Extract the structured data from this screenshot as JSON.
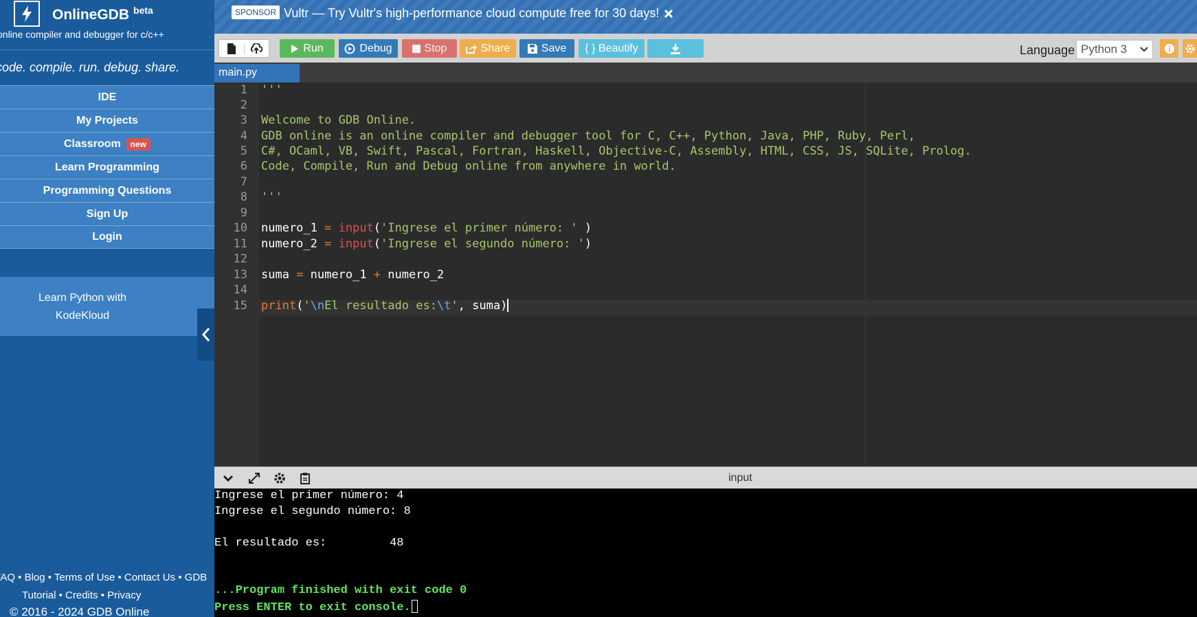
{
  "brand": {
    "name": "OnlineGDB",
    "sup": "beta",
    "tagline": "online compiler and debugger for c/c++",
    "slogan": "code. compile. run. debug. share."
  },
  "nav": {
    "ide": "IDE",
    "projects": "My Projects",
    "classroom": "Classroom",
    "classroom_badge": "new",
    "learn": "Learn Programming",
    "questions": "Programming Questions",
    "signup": "Sign Up",
    "login": "Login"
  },
  "promo": {
    "line1": "Learn Python with",
    "line2": "KodeKloud"
  },
  "footer": {
    "line1": "FAQ • Blog • Terms of Use • Contact Us • GDB",
    "line2": "Tutorial • Credits • Privacy",
    "line3": "© 2016 - 2024 GDB Online"
  },
  "sponsor": {
    "badge": "SPONSOR",
    "text": "Vultr — Try Vultr's high-performance cloud compute free for 30 days!"
  },
  "toolbar": {
    "run": "Run",
    "debug": "Debug",
    "stop": "Stop",
    "share": "Share",
    "save": "Save",
    "beautify": "{ } Beautify",
    "language_label": "Language",
    "language_value": "Python 3",
    "colors": {
      "run": "#5cb85c",
      "debug": "#337ab7",
      "stop": "#d9534f",
      "share": "#f0ad4e",
      "save": "#337ab7",
      "beautify": "#5bc0de",
      "info": "#f0ad4e"
    }
  },
  "tab": {
    "filename": "main.py"
  },
  "editor": {
    "line_numbers": [
      "1",
      "2",
      "3",
      "4",
      "5",
      "6",
      "7",
      "8",
      "9",
      "10",
      "11",
      "12",
      "13",
      "14",
      "15"
    ],
    "l1": "'''",
    "l3": "Welcome to GDB Online.",
    "l4": "GDB online is an online compiler and debugger tool for C, C++, Python, Java, PHP, Ruby, Perl,",
    "l5": "C#, OCaml, VB, Swift, Pascal, Fortran, Haskell, Objective-C, Assembly, HTML, CSS, JS, SQLite, Prolog.",
    "l6": "Code, Compile, Run and Debug online from anywhere in world.",
    "l8": "'''",
    "l10": {
      "var": "numero_1",
      "eq": " = ",
      "fn": "input",
      "open": "(",
      "str": "'Ingrese el primer número: '",
      "close": " )"
    },
    "l11": {
      "var": "numero_2",
      "eq": " = ",
      "fn": "input",
      "open": "(",
      "str": "'Ingrese el segundo número: '",
      "close": ")"
    },
    "l13": {
      "var": "suma",
      "eq": " = ",
      "a": "numero_1",
      "plus": " + ",
      "b": "numero_2"
    },
    "l15": {
      "fn": "print",
      "open": "(",
      "q1": "'",
      "esc1": "\\n",
      "mid": "El resultado es:",
      "esc2": "\\t",
      "q2": "'",
      "comma": ", ",
      "arg": "suma",
      "close": ")"
    }
  },
  "console": {
    "title": "input",
    "lines": [
      "Ingrese el primer número: 4",
      "Ingrese el segundo número: 8",
      "",
      "El resultado es:         48",
      "",
      "",
      "...Program finished with exit code 0",
      "Press ENTER to exit console."
    ]
  },
  "icons": [
    "bolt-icon",
    "new-file-icon",
    "upload-icon",
    "play-icon",
    "debug-icon",
    "stop-icon",
    "share-icon",
    "save-icon",
    "download-icon",
    "info-icon",
    "gear-icon",
    "chevron-left-icon",
    "close-icon",
    "chevron-down-icon",
    "expand-icon",
    "copy-icon"
  ]
}
